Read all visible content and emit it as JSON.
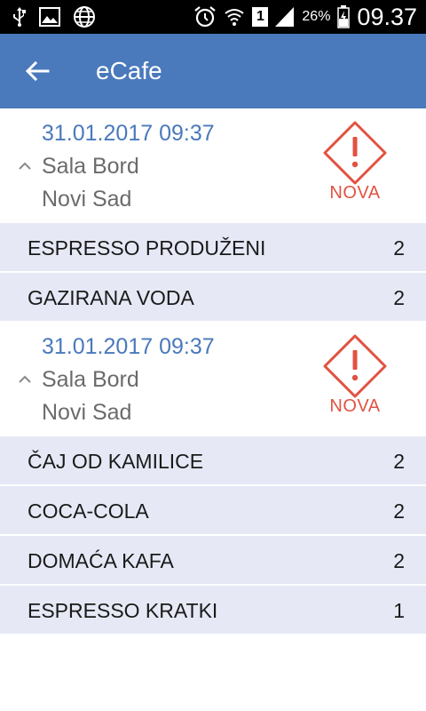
{
  "status_bar": {
    "battery": "26%",
    "sim": "1",
    "time": "09.37",
    "icons": [
      "usb-icon",
      "image-icon",
      "globe-icon",
      "alarm-icon",
      "wifi-icon",
      "signal-icon",
      "battery-icon"
    ]
  },
  "app_bar": {
    "title": "eCafe",
    "back_icon": "arrow-left-icon"
  },
  "colors": {
    "primary": "#4a79bc",
    "alert": "#e15241",
    "row_bg": "#e6e9f5"
  },
  "orders": [
    {
      "datetime": "31.01.2017 09:37",
      "room": "Sala Bord",
      "city": "Novi Sad",
      "status": "NOVA",
      "items": [
        {
          "name": "ESPRESSO PRODUŽENI",
          "qty": "2"
        },
        {
          "name": "GAZIRANA VODA",
          "qty": "2"
        }
      ]
    },
    {
      "datetime": "31.01.2017 09:37",
      "room": "Sala Bord",
      "city": "Novi Sad",
      "status": "NOVA",
      "items": [
        {
          "name": "ČAJ OD KAMILICE",
          "qty": "2"
        },
        {
          "name": "COCA-COLA",
          "qty": "2"
        },
        {
          "name": "DOMAĆA KAFA",
          "qty": "2"
        },
        {
          "name": "ESPRESSO KRATKI",
          "qty": "1"
        }
      ]
    }
  ]
}
